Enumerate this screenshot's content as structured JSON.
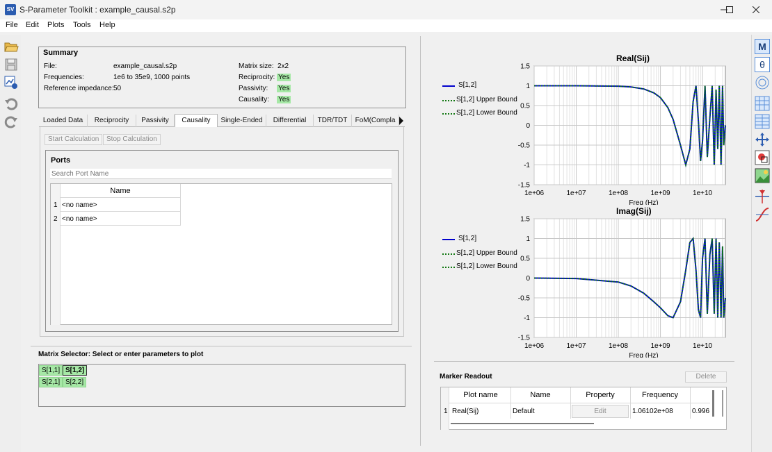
{
  "window": {
    "app_icon": "SV",
    "title": "S-Parameter Toolkit : example_causal.s2p"
  },
  "menu": [
    "File",
    "Edit",
    "Plots",
    "Tools",
    "Help"
  ],
  "summary": {
    "title": "Summary",
    "file_label": "File:",
    "file_value": "example_causal.s2p",
    "freq_label": "Frequencies:",
    "freq_value": "1e6 to 35e9,  1000 points",
    "ref_label": "Reference impedance:",
    "ref_value": "50",
    "matrix_label": "Matrix size:",
    "matrix_value": "2x2",
    "reciprocity_label": "Reciprocity:",
    "reciprocity_value": "Yes",
    "passivity_label": "Passivity:",
    "passivity_value": "Yes",
    "causality_label": "Causality:",
    "causality_value": "Yes"
  },
  "tabs": [
    "Loaded Data",
    "Reciprocity",
    "Passivity",
    "Causality",
    "Single-Ended",
    "Differential",
    "TDR/TDT",
    "FoM(Compla"
  ],
  "active_tab": "Causality",
  "buttons": {
    "start": "Start Calculation",
    "stop": "Stop Calculation",
    "delete": "Delete"
  },
  "ports": {
    "title": "Ports",
    "search_placeholder": "Search Port Name",
    "column": "Name",
    "rows": [
      {
        "index": "1",
        "name": "<no name>"
      },
      {
        "index": "2",
        "name": "<no name>"
      }
    ]
  },
  "matrix_selector": {
    "title": "Matrix Selector: Select or enter parameters to plot",
    "cells": [
      "S[1,1]",
      "S[1,2]",
      "S[2,1]",
      "S[2,2]"
    ],
    "selected": "S[1,2]"
  },
  "charts": {
    "legend": [
      "S[1,2]",
      "S[1,2] Upper Bound",
      "S[1,2] Lower Bound"
    ],
    "colors": {
      "main": "#0000cc",
      "bound": "#117711",
      "grid": "#c8c8c8"
    }
  },
  "chart_data": [
    {
      "type": "line",
      "title": "Real(Sij)",
      "xlabel": "Freq (Hz)",
      "ylabel": "",
      "x_scale": "log",
      "xlim": [
        1000000.0,
        35000000000.0
      ],
      "ylim": [
        -1.5,
        1.5
      ],
      "x_ticks": [
        "1e+06",
        "1e+07",
        "1e+08",
        "1e+09",
        "1e+10"
      ],
      "y_ticks": [
        "1.5",
        "1",
        "0.5",
        "0",
        "-0.5",
        "-1",
        "-1.5"
      ],
      "grid": true,
      "legend_position": "left",
      "x": [
        1000000.0,
        10000000.0,
        100000000.0,
        200000000.0,
        400000000.0,
        700000000.0,
        1000000000.0,
        1500000000.0,
        2000000000.0,
        3000000000.0,
        4000000000.0,
        5000000000.0,
        6000000000.0,
        7000000000.0,
        8000000000.0,
        9000000000.0,
        10000000000.0,
        11500000000.0,
        13000000000.0,
        15000000000.0,
        17000000000.0,
        19000000000.0,
        21000000000.0,
        23000000000.0,
        25000000000.0,
        27500000000.0,
        30000000000.0,
        32000000000.0,
        35000000000.0
      ],
      "series": [
        {
          "name": "S[1,2]",
          "values": [
            1,
            1,
            0.99,
            0.97,
            0.92,
            0.82,
            0.7,
            0.45,
            0.15,
            -0.5,
            -1.0,
            -0.6,
            0.6,
            1.0,
            0.1,
            -0.9,
            -0.4,
            1.0,
            -0.8,
            0.2,
            1.0,
            -1.0,
            0.9,
            -0.6,
            1.0,
            -1.0,
            1.0,
            -0.5,
            0.0
          ]
        },
        {
          "name": "S[1,2] Upper Bound",
          "values": [
            1,
            1,
            0.99,
            0.97,
            0.92,
            0.82,
            0.7,
            0.45,
            0.15,
            -0.5,
            -1.0,
            -0.6,
            0.6,
            1.0,
            0.1,
            -0.9,
            -0.4,
            1.0,
            -0.8,
            0.2,
            1.0,
            -1.0,
            0.9,
            -0.6,
            1.0,
            -1.0,
            1.0,
            -0.5,
            0.0
          ]
        },
        {
          "name": "S[1,2] Lower Bound",
          "values": [
            1,
            1,
            0.99,
            0.97,
            0.92,
            0.82,
            0.7,
            0.45,
            0.15,
            -0.5,
            -1.0,
            -0.6,
            0.6,
            1.0,
            0.1,
            -0.9,
            -0.4,
            1.0,
            -0.8,
            0.2,
            1.0,
            -1.0,
            0.9,
            -0.6,
            1.0,
            -1.0,
            1.0,
            -0.5,
            0.0
          ]
        }
      ]
    },
    {
      "type": "line",
      "title": "Imag(Sij)",
      "xlabel": "Freq (Hz)",
      "ylabel": "",
      "x_scale": "log",
      "xlim": [
        1000000.0,
        35000000000.0
      ],
      "ylim": [
        -1.5,
        1.5
      ],
      "x_ticks": [
        "1e+06",
        "1e+07",
        "1e+08",
        "1e+09",
        "1e+10"
      ],
      "y_ticks": [
        "1.5",
        "1",
        "0.5",
        "0",
        "-0.5",
        "-1",
        "-1.5"
      ],
      "grid": true,
      "legend_position": "left",
      "x": [
        1000000.0,
        10000000.0,
        100000000.0,
        200000000.0,
        400000000.0,
        700000000.0,
        1000000000.0,
        1500000000.0,
        2000000000.0,
        3000000000.0,
        4000000000.0,
        5000000000.0,
        6000000000.0,
        7000000000.0,
        8000000000.0,
        9000000000.0,
        10000000000.0,
        11500000000.0,
        13000000000.0,
        15000000000.0,
        17000000000.0,
        19000000000.0,
        21000000000.0,
        23000000000.0,
        25000000000.0,
        27500000000.0,
        30000000000.0,
        32000000000.0,
        35000000000.0
      ],
      "series": [
        {
          "name": "S[1,2]",
          "values": [
            0,
            -0.01,
            -0.1,
            -0.2,
            -0.38,
            -0.6,
            -0.75,
            -0.95,
            -1.0,
            -0.6,
            0.2,
            0.9,
            1.0,
            0.2,
            -0.8,
            -1.0,
            0.5,
            1.0,
            -0.9,
            0.6,
            1.0,
            -0.9,
            1.0,
            -1.0,
            0.9,
            -1.0,
            0.8,
            -1.0,
            -0.5
          ]
        },
        {
          "name": "S[1,2] Upper Bound",
          "values": [
            0,
            -0.01,
            -0.1,
            -0.2,
            -0.38,
            -0.6,
            -0.75,
            -0.95,
            -1.0,
            -0.6,
            0.2,
            0.9,
            1.0,
            0.2,
            -0.8,
            -1.0,
            0.5,
            1.0,
            -0.9,
            0.6,
            1.0,
            -0.9,
            1.0,
            -1.0,
            0.9,
            -1.0,
            0.8,
            -1.0,
            -0.5
          ]
        },
        {
          "name": "S[1,2] Lower Bound",
          "values": [
            0,
            -0.01,
            -0.1,
            -0.2,
            -0.38,
            -0.6,
            -0.75,
            -0.95,
            -1.0,
            -0.6,
            0.2,
            0.9,
            1.0,
            0.2,
            -0.8,
            -1.0,
            0.5,
            1.0,
            -0.9,
            0.6,
            1.0,
            -0.9,
            1.0,
            -1.0,
            0.9,
            -1.0,
            0.8,
            -1.0,
            -0.5
          ]
        }
      ]
    }
  ],
  "marker_readout": {
    "title": "Marker Readout",
    "columns": [
      "Plot name",
      "Name",
      "Property",
      "Frequency"
    ],
    "row": {
      "index": "1",
      "plot_name": "Real(Sij)",
      "name": "Default",
      "property": "Edit",
      "frequency": "1.06102e+08",
      "value": "0.996"
    }
  }
}
